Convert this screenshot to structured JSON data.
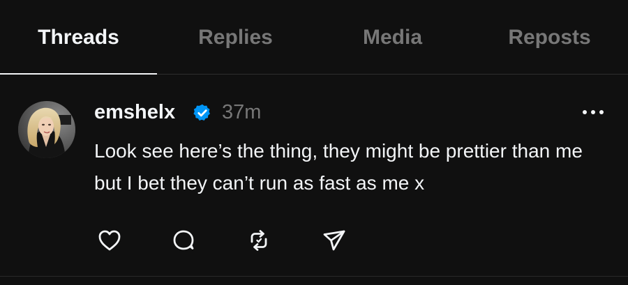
{
  "tabs": [
    {
      "label": "Threads",
      "active": true
    },
    {
      "label": "Replies",
      "active": false
    },
    {
      "label": "Media",
      "active": false
    },
    {
      "label": "Reposts",
      "active": false
    }
  ],
  "post": {
    "username": "emshelx",
    "verified": true,
    "timestamp": "37m",
    "text": "Look see here’s the thing, they might be prettier than me but I bet they can’t run as fast as me x",
    "actions": [
      "heart-icon",
      "comment-icon",
      "repost-icon",
      "share-icon"
    ]
  },
  "colors": {
    "background": "#101010",
    "text_primary": "#f3f5f7",
    "text_secondary": "#777777",
    "verified_blue": "#0095f6"
  }
}
